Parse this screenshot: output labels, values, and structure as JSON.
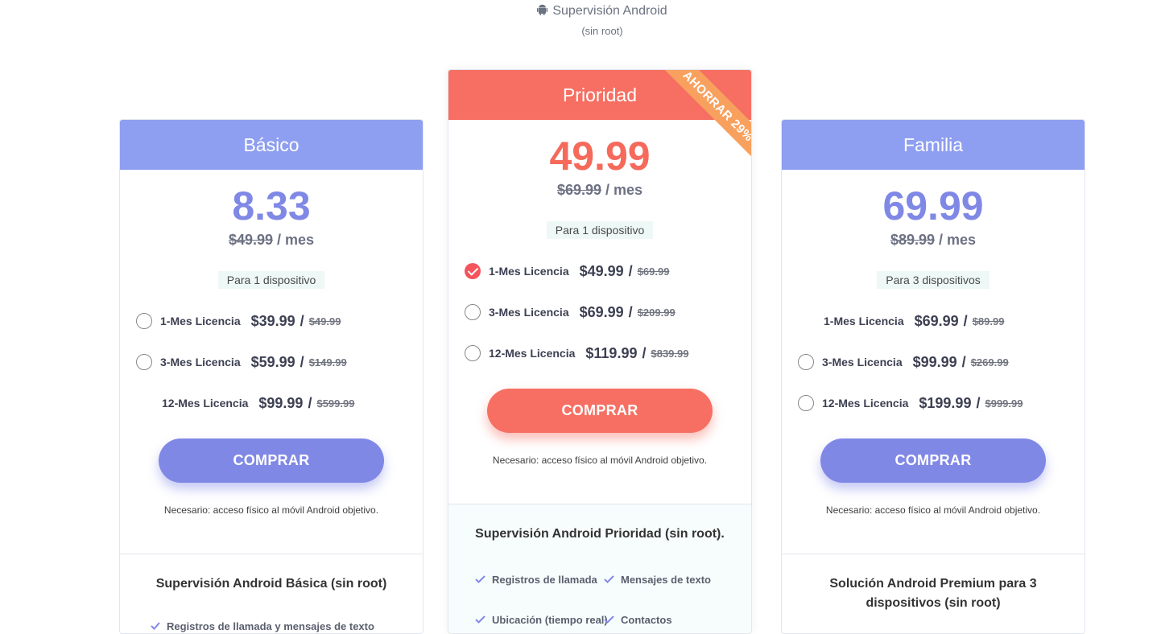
{
  "header": {
    "title": "Supervisión Android",
    "subtitle": "(sin root)",
    "icon": "android-icon"
  },
  "colors": {
    "blue_accent": "#8088e6",
    "blue_header": "#8e9ef0",
    "red_accent": "#f66f62",
    "ribbon": "#f8a15f"
  },
  "plans": [
    {
      "name": "Básico",
      "price": "8.33",
      "old_price": "$49.99",
      "per": "/ mes",
      "devices": "Para 1 dispositivo",
      "options": [
        {
          "label": "1-Mes Licencia",
          "price": "$39.99",
          "slash": "/",
          "old": "$49.99"
        },
        {
          "label": "3-Mes Licencia",
          "price": "$59.99",
          "slash": "/",
          "old": "$149.99"
        },
        {
          "label": "12-Mes Licencia",
          "price": "$99.99",
          "slash": "/",
          "old": "$599.99"
        }
      ],
      "buy": "COMPRAR",
      "note": "Necesario: acceso físico al móvil Android objetivo.",
      "feature_title": "Supervisión Android Básica (sin root)",
      "features_partial": "Registros de llamada y mensajes de texto"
    },
    {
      "name": "Prioridad",
      "ribbon": "AHORRAR 29%",
      "price": "49.99",
      "old_price": "$69.99",
      "per": "/ mes",
      "devices": "Para 1 dispositivo",
      "options": [
        {
          "label": "1-Mes Licencia",
          "price": "$49.99",
          "slash": "/",
          "old": "$69.99"
        },
        {
          "label": "3-Mes Licencia",
          "price": "$69.99",
          "slash": "/",
          "old": "$209.99"
        },
        {
          "label": "12-Mes Licencia",
          "price": "$119.99",
          "slash": "/",
          "old": "$839.99"
        }
      ],
      "buy": "COMPRAR",
      "note": "Necesario: acceso físico al móvil Android objetivo.",
      "feature_title": "Supervisión Android Prioridad (sin root).",
      "features": [
        "Registros de llamada",
        "Mensajes de texto",
        "Ubicación (tiempo real)",
        "Contactos"
      ]
    },
    {
      "name": "Familia",
      "price": "69.99",
      "old_price": "$89.99",
      "per": "/ mes",
      "devices": "Para 3 dispositivos",
      "options": [
        {
          "label": "1-Mes Licencia",
          "price": "$69.99",
          "slash": "/",
          "old": "$89.99"
        },
        {
          "label": "3-Mes Licencia",
          "price": "$99.99",
          "slash": "/",
          "old": "$269.99"
        },
        {
          "label": "12-Mes Licencia",
          "price": "$199.99",
          "slash": "/",
          "old": "$999.99"
        }
      ],
      "buy": "COMPRAR",
      "note": "Necesario: acceso físico al móvil Android objetivo.",
      "feature_title": "Solución Android Premium para 3 dispositivos (sin root)"
    }
  ]
}
